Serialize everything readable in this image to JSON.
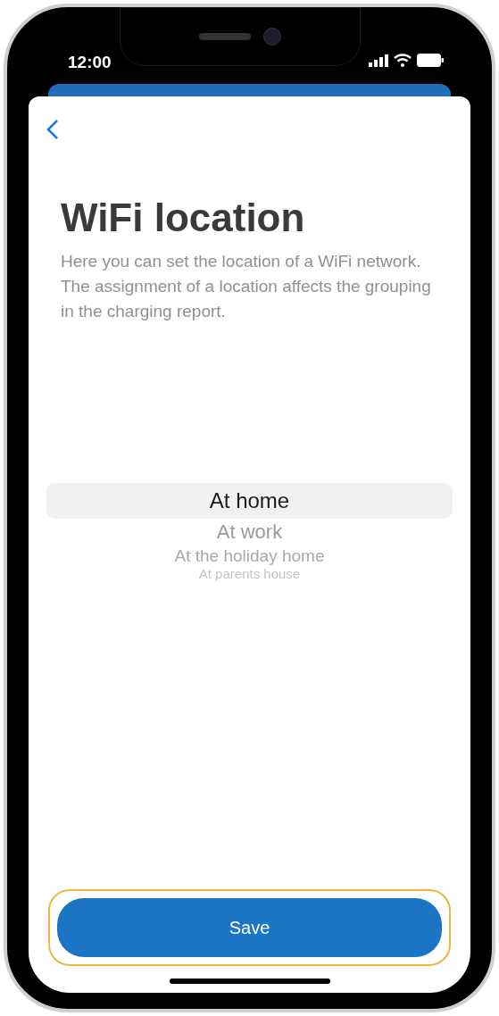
{
  "status_bar": {
    "time": "12:00"
  },
  "page": {
    "title": "WiFi location",
    "description": "Here you can set the location of a WiFi network. The assignment of a location affects the grouping in the charging report."
  },
  "picker": {
    "options": [
      {
        "label": "At home",
        "selected": true
      },
      {
        "label": "At work",
        "selected": false
      },
      {
        "label": "At the holiday home",
        "selected": false
      },
      {
        "label": "At parents house",
        "selected": false
      }
    ]
  },
  "save_button": {
    "label": "Save",
    "focused": true
  }
}
